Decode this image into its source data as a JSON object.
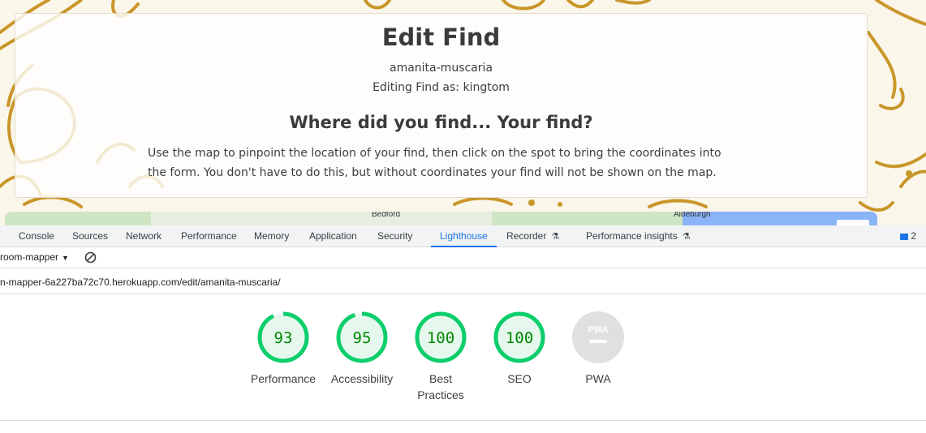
{
  "page": {
    "title": "Edit Find",
    "slug": "amanita-muscaria",
    "editing_as": "Editing Find as: kingtom",
    "heading": "Where did you find... Your find?",
    "instructions_line1": "Use the map to pinpoint the location of your find, then click on the spot to bring the coordinates into",
    "instructions_line2": "the form. You don't have to do this, but without coordinates your find will not be shown on the map.",
    "map_labels": {
      "bedford": "Bedford",
      "aldeburgh": "Aldeburgh"
    }
  },
  "devtools": {
    "tabs": [
      {
        "label": "Console"
      },
      {
        "label": "Sources"
      },
      {
        "label": "Network"
      },
      {
        "label": "Performance"
      },
      {
        "label": "Memory"
      },
      {
        "label": "Application"
      },
      {
        "label": "Security"
      },
      {
        "label": "Lighthouse",
        "active": true
      },
      {
        "label": "Recorder",
        "flask": true
      },
      {
        "label": "Performance insights",
        "flask": true
      }
    ],
    "issues_count": "2",
    "target_select": "room-mapper",
    "url": "n-mapper-6a227ba72c70.herokuapp.com/edit/amanita-muscaria/",
    "scores": [
      {
        "label": "Performance",
        "value": "93",
        "fraction": 0.93
      },
      {
        "label": "Accessibility",
        "value": "95",
        "fraction": 0.95
      },
      {
        "label": "Best Practices",
        "value": "100",
        "fraction": 1.0
      },
      {
        "label": "SEO",
        "value": "100",
        "fraction": 1.0
      },
      {
        "label": "PWA",
        "value": "PWA",
        "fraction": 0
      }
    ],
    "colors": {
      "pass": "#0cce6b",
      "pass_bg": "#e6f8ee",
      "pass_text": "#008800",
      "pwa_bg": "#e0e0e0",
      "accent": "#1a73e8"
    }
  }
}
